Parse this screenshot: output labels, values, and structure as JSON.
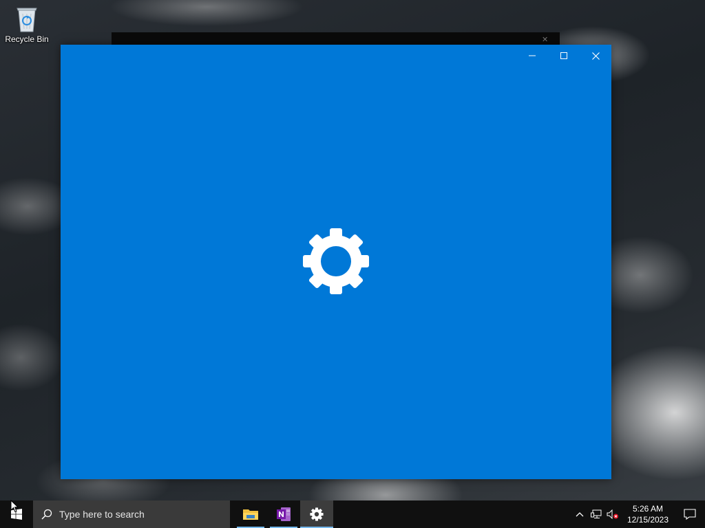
{
  "desktop": {
    "icons": [
      {
        "label": "Recycle Bin",
        "icon": "recycle-bin-icon"
      }
    ]
  },
  "settings_window": {
    "splash_icon": "gear-icon",
    "background_color": "#0078d7",
    "controls": {
      "minimize": "minimize-icon",
      "maximize": "maximize-icon",
      "close": "close-icon"
    }
  },
  "taskbar": {
    "start_icon": "windows-logo-icon",
    "search": {
      "placeholder": "Type here to search",
      "icon": "search-icon"
    },
    "apps": [
      {
        "name": "File Explorer",
        "icon": "folder-icon",
        "running": true,
        "active": false
      },
      {
        "name": "OneNote",
        "icon": "onenote-icon",
        "running": true,
        "active": false
      },
      {
        "name": "Settings",
        "icon": "gear-icon",
        "running": true,
        "active": true
      }
    ],
    "tray": {
      "icons": [
        "chevron-up-icon",
        "network-icon",
        "volume-muted-icon"
      ],
      "time": "5:26 AM",
      "date": "12/15/2023",
      "notification_icon": "notification-icon"
    },
    "accent_color": "#76b9ed"
  }
}
